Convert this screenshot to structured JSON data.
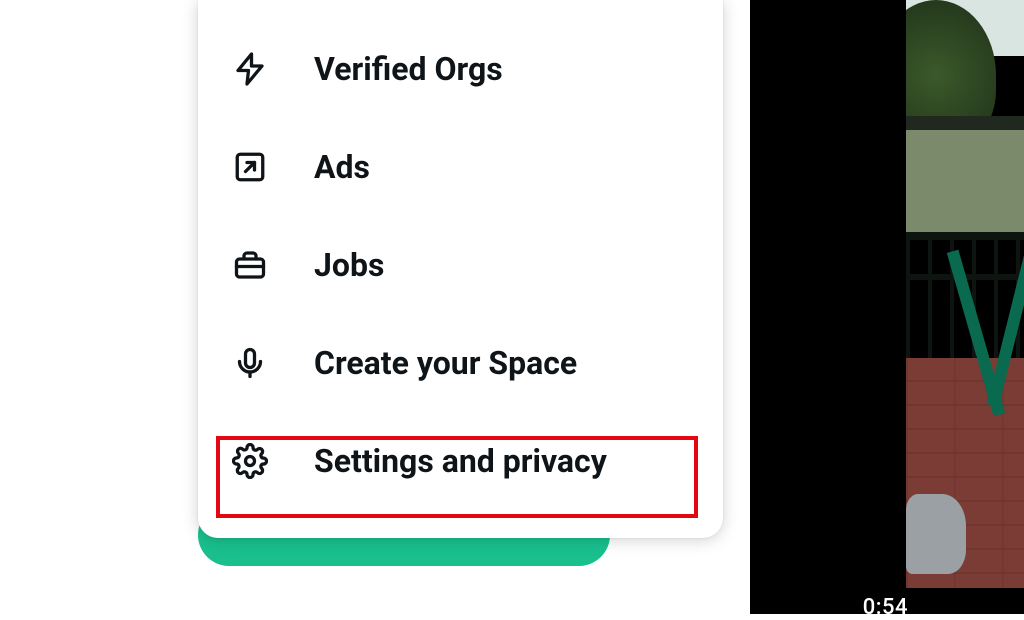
{
  "menu": {
    "items": [
      {
        "label": "Verified Orgs"
      },
      {
        "label": "Ads"
      },
      {
        "label": "Jobs"
      },
      {
        "label": "Create your Space"
      },
      {
        "label": "Settings and privacy"
      }
    ]
  },
  "video": {
    "timecode": "0:54"
  }
}
